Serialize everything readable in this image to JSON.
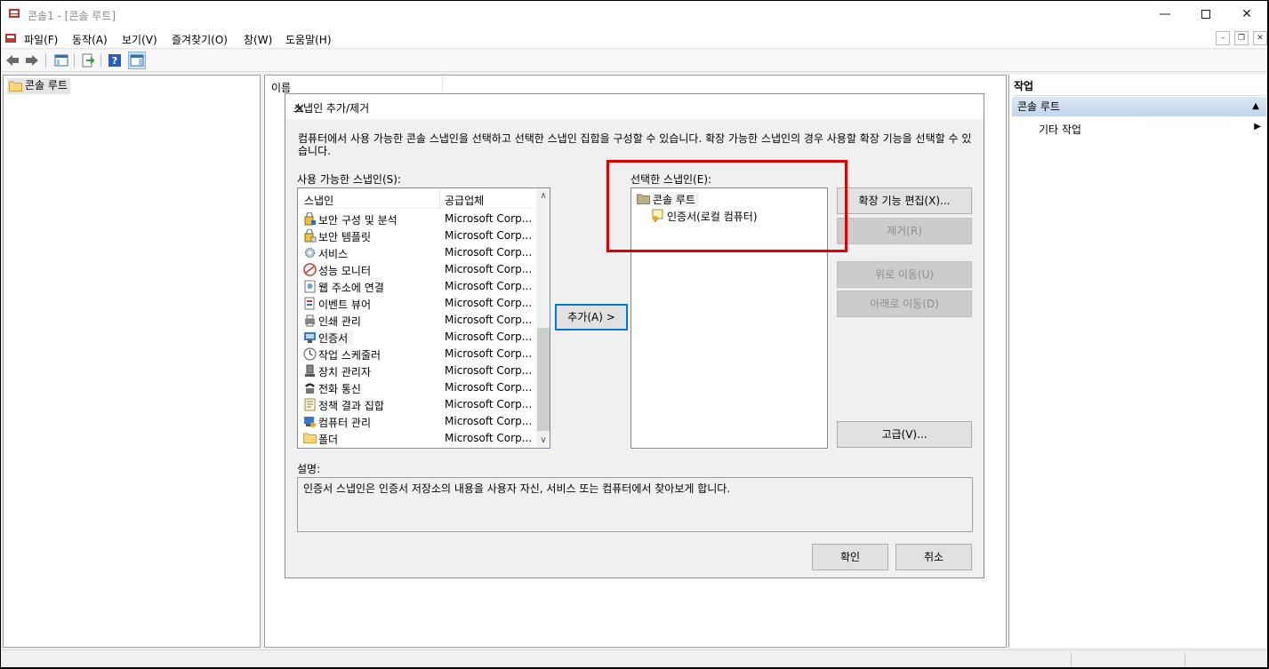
{
  "window": {
    "title": "콘솔1 - [콘솔 루트]"
  },
  "menu": [
    "파일(F)",
    "동작(A)",
    "보기(V)",
    "즐겨찾기(O)",
    "창(W)",
    "도움말(H)"
  ],
  "left_tree": {
    "root": "콘솔 루트"
  },
  "middle": {
    "column": "이름"
  },
  "actions": {
    "header": "작업",
    "section": "콘솔 루트",
    "item": "기타 작업"
  },
  "dialog": {
    "title": "스냅인 추가/제거",
    "description": "컴퓨터에서 사용 가능한 콘솔 스냅인을 선택하고 선택한 스냅인 집합을 구성할 수 있습니다. 확장 가능한 스냅인의 경우 사용할 확장 기능을 선택할 수 있습니다.",
    "available_label": "사용 가능한 스냅인(S):",
    "columns": [
      "스냅인",
      "공급업체"
    ],
    "available": [
      {
        "name": "보안 구성 및 분석",
        "vendor": "Microsoft Corp...",
        "icon": "security-config-icon"
      },
      {
        "name": "보안 템플릿",
        "vendor": "Microsoft Corp...",
        "icon": "security-template-icon"
      },
      {
        "name": "서비스",
        "vendor": "Microsoft Corp...",
        "icon": "services-gear-icon"
      },
      {
        "name": "성능 모니터",
        "vendor": "Microsoft Corp...",
        "icon": "performance-monitor-icon"
      },
      {
        "name": "웹 주소에 연결",
        "vendor": "Microsoft Corp...",
        "icon": "web-link-icon"
      },
      {
        "name": "이벤트 뷰어",
        "vendor": "Microsoft Corp...",
        "icon": "event-viewer-icon"
      },
      {
        "name": "인쇄 관리",
        "vendor": "Microsoft Corp...",
        "icon": "print-management-icon"
      },
      {
        "name": "인증서",
        "vendor": "Microsoft Corp...",
        "icon": "certificates-icon"
      },
      {
        "name": "작업 스케줄러",
        "vendor": "Microsoft Corp...",
        "icon": "clock-icon"
      },
      {
        "name": "장치 관리자",
        "vendor": "Microsoft Corp...",
        "icon": "device-manager-icon"
      },
      {
        "name": "전화 통신",
        "vendor": "Microsoft Corp...",
        "icon": "telephony-icon"
      },
      {
        "name": "정책 결과 집합",
        "vendor": "Microsoft Corp...",
        "icon": "policy-results-icon"
      },
      {
        "name": "컴퓨터 관리",
        "vendor": "Microsoft Corp...",
        "icon": "computer-management-icon"
      },
      {
        "name": "폴더",
        "vendor": "Microsoft Corp...",
        "icon": "folder-icon"
      }
    ],
    "add_button": "추가(A) >",
    "selected_label": "선택한 스냅인(E):",
    "selected_root": "콘솔 루트",
    "selected_child": "인증서(로컬 컴퓨터)",
    "buttons": {
      "edit_extensions": "확장 기능 편집(X)...",
      "remove": "제거(R)",
      "move_up": "위로 이동(U)",
      "move_down": "아래로 이동(D)",
      "advanced": "고급(V)...",
      "ok": "확인",
      "cancel": "취소"
    },
    "desc_label": "설명:",
    "desc_text": "인증서 스냅인은 인증서 저장소의 내용을 사용자 자신, 서비스 또는 컴퓨터에서 찾아보게 합니다."
  },
  "colors": {
    "highlight": "#e00000",
    "focus": "#0078d7",
    "section": "#c4d6ea"
  }
}
